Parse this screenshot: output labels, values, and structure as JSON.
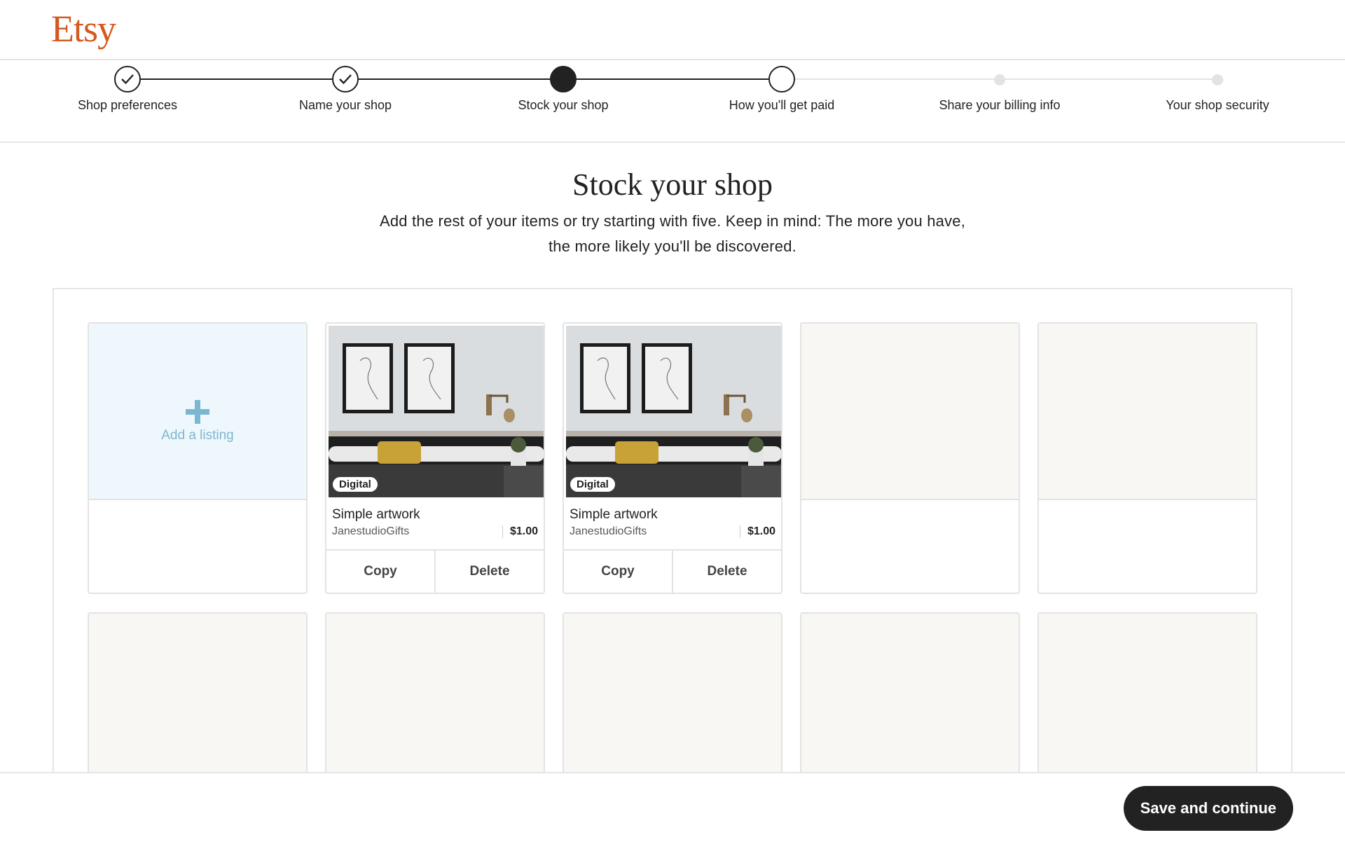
{
  "brand": {
    "logo": "Etsy",
    "color": "#d5581f"
  },
  "progress": {
    "steps": [
      {
        "label": "Shop preferences",
        "state": "done"
      },
      {
        "label": "Name your shop",
        "state": "done"
      },
      {
        "label": "Stock your shop",
        "state": "current"
      },
      {
        "label": "How you'll get paid",
        "state": "next"
      },
      {
        "label": "Share your billing info",
        "state": "future"
      },
      {
        "label": "Your shop security",
        "state": "future"
      }
    ]
  },
  "page": {
    "title": "Stock your shop",
    "subtitle": "Add the rest of your items or try starting with five. Keep in mind: The more you have, the more likely you'll be discovered."
  },
  "add_listing": {
    "label": "Add a listing",
    "icon": "plus-icon"
  },
  "listings": [
    {
      "badge": "Digital",
      "name": "Simple artwork",
      "shop": "JanestudioGifts",
      "price": "$1.00",
      "copy_label": "Copy",
      "delete_label": "Delete"
    },
    {
      "badge": "Digital",
      "name": "Simple artwork",
      "shop": "JanestudioGifts",
      "price": "$1.00",
      "copy_label": "Copy",
      "delete_label": "Delete"
    }
  ],
  "footer": {
    "save_label": "Save and continue"
  }
}
